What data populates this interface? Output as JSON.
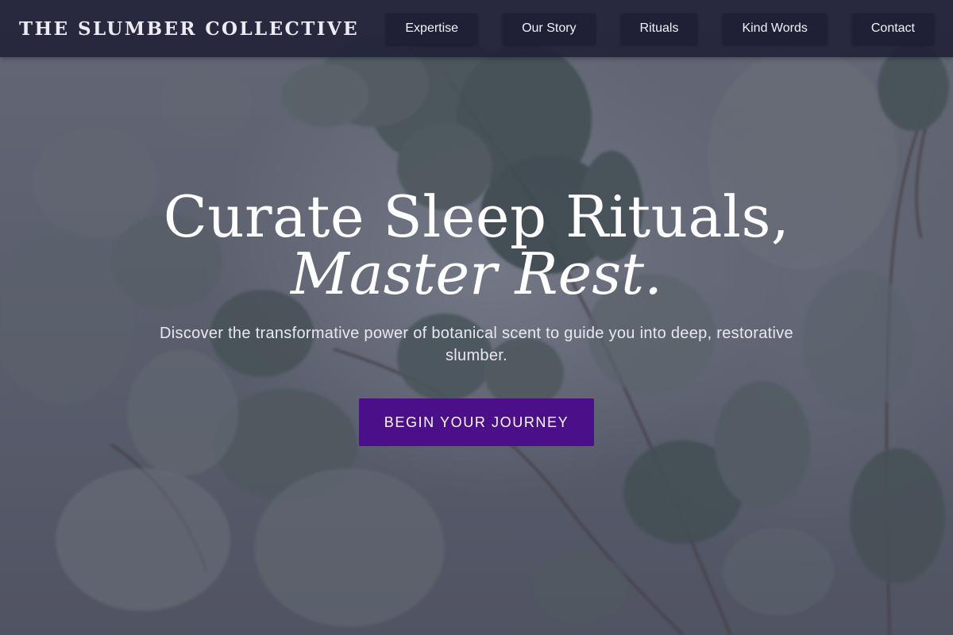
{
  "brand": {
    "name": "THE SLUMBER COLLECTIVE"
  },
  "nav": {
    "items": [
      {
        "label": "Expertise"
      },
      {
        "label": "Our Story"
      },
      {
        "label": "Rituals"
      },
      {
        "label": "Kind Words"
      },
      {
        "label": "Contact"
      }
    ]
  },
  "hero": {
    "headline_line1": "Curate Sleep Rituals,",
    "headline_line2": "Master Rest.",
    "subtitle": "Discover the transformative power of botanical scent to guide you into deep, restorative slumber.",
    "cta_label": "BEGIN YOUR JOURNEY"
  },
  "colors": {
    "navbar_bg": "#1e1e36",
    "nav_button_bg": "#1f1f35",
    "cta_bg": "#4b0f8a",
    "overlay": "#2c2a4a",
    "leaf": "#5e6f63"
  }
}
